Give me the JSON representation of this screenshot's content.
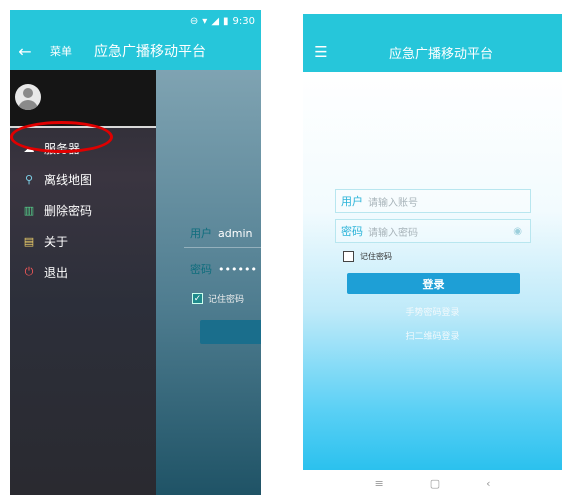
{
  "left_screen": {
    "status_bar": {
      "time": "9:30",
      "icons": [
        "minus-circle-icon",
        "wifi-icon",
        "signal-icon",
        "battery-icon"
      ]
    },
    "app_bar": {
      "back_icon": "arrow-left-icon",
      "menu_label": "菜单",
      "title": "应急广播移动平台"
    },
    "drawer": {
      "avatar_icon": "user-avatar-icon",
      "items": [
        {
          "label": "服务器",
          "icon": "cloud-icon"
        },
        {
          "label": "离线地图",
          "icon": "map-pin-icon"
        },
        {
          "label": "删除密码",
          "icon": "trash-icon"
        },
        {
          "label": "关于",
          "icon": "clipboard-icon"
        },
        {
          "label": "退出",
          "icon": "power-icon"
        }
      ]
    },
    "background_form": {
      "user_label": "用户",
      "user_value": "admin",
      "pwd_label": "密码",
      "pwd_value": "••••••",
      "remember_label": "记住密码"
    }
  },
  "right_screen": {
    "app_bar": {
      "menu_icon": "hamburger-icon",
      "title": "应急广播移动平台"
    },
    "login": {
      "user_label": "用户",
      "user_placeholder": "请输入账号",
      "pwd_label": "密码",
      "pwd_placeholder": "请输入密码",
      "remember_label": "记住密码",
      "login_button": "登录",
      "gesture_link": "手势密码登录",
      "qr_link": "扫二维码登录"
    },
    "nav_bar": {
      "menu_icon": "menu-lines-icon",
      "home_icon": "square-icon",
      "back_icon": "chevron-left-icon"
    }
  },
  "colors": {
    "accent": "#26c6da",
    "highlight": "#e00000",
    "login_button": "#1e9fd6"
  }
}
